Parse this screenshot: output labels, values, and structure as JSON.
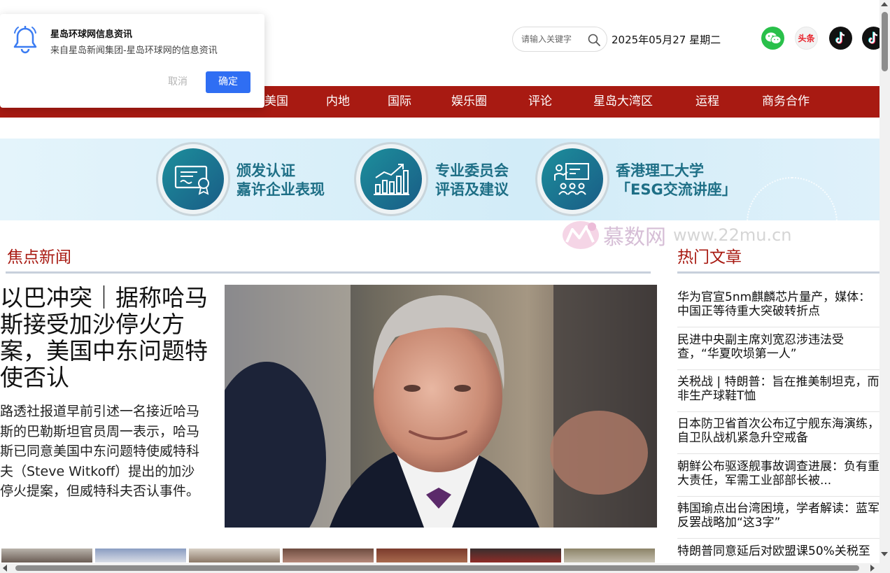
{
  "header": {
    "search": {
      "placeholder": "请输入关键字",
      "icon": "search-icon"
    },
    "date": "2025年05月27 星期二",
    "social": [
      {
        "name": "wechat",
        "icon": "wechat-icon",
        "color": "#29c04a"
      },
      {
        "name": "toutiao",
        "label": "头条",
        "icon": "toutiao-icon",
        "color": "#e8212a"
      },
      {
        "name": "douyin",
        "icon": "douyin-icon",
        "color": "#111111"
      },
      {
        "name": "douyin",
        "icon": "douyin-icon",
        "color": "#111111"
      }
    ]
  },
  "nav": {
    "color": "#a81a12",
    "items": [
      "美国",
      "内地",
      "国际",
      "娱乐圈",
      "评论",
      "星岛大湾区",
      "运程",
      "商务合作"
    ]
  },
  "banner": {
    "items": [
      {
        "line1": "颁发认证",
        "line2": "嘉许企业表现",
        "icon": "certificate-icon"
      },
      {
        "line1": "专业委员会",
        "line2": "评语及建议",
        "icon": "growth-chart-icon"
      },
      {
        "line1": "香港理工大学",
        "line2": "「ESG交流讲座」",
        "icon": "lecture-icon"
      }
    ]
  },
  "watermark": {
    "name": "慕数网",
    "url": "www.22mu.cn"
  },
  "focus": {
    "section_title": "焦点新闻",
    "headline": "以巴冲突｜据称哈马斯接受加沙停火方案，美国中东问题特使否认",
    "summary": "路透社报道早前引述一名接近哈马斯的巴勒斯坦官员周一表示，哈马斯已同意美国中东问题特使威特科夫（Steve Witkoff）提出的加沙停火提案，但威特科夫否认事件。"
  },
  "hot": {
    "section_title": "热门文章",
    "items": [
      "华为官宣5nm麒麟芯片量产，媒体：中国正等待重大突破转折点",
      "民进中央副主席刘宽忍涉违法受查，“华夏吹埙第一人”",
      "关税战 | 特朗普：旨在推美制坦克，而非生产球鞋T恤",
      "日本防卫省首次公布辽宁舰东海演练，自卫队战机紧急升空戒备",
      "朝鲜公布驱逐舰事故调查进展：负有重大责任，军需工业部部长被...",
      "韩国瑜点出台湾困境，学者解读：蓝军反罢战略加“这3字”",
      "特朗普同意延后对欧盟课50%关税至"
    ]
  },
  "notification": {
    "icon": "bell-icon",
    "title": "星岛环球网信息资讯",
    "description": "来自星岛新闻集团-星岛环球网的信息资讯",
    "cancel_label": "取消",
    "confirm_label": "确定",
    "confirm_color": "#2f6ef3"
  }
}
